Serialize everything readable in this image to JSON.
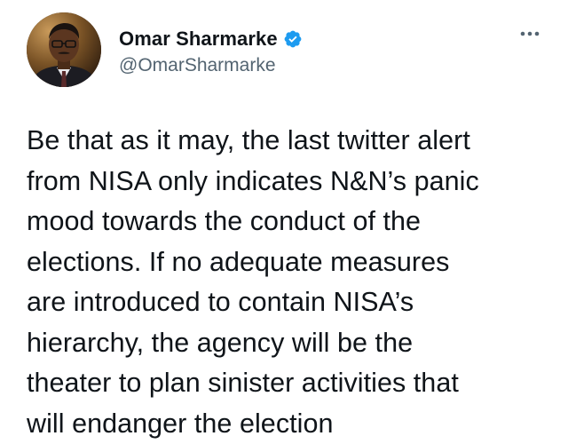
{
  "author": {
    "display_name": "Omar Sharmarke",
    "handle": "@OmarSharmarke",
    "verified": true,
    "verified_color": "#1d9bf0",
    "avatar_icon": "user-avatar-photo"
  },
  "menu": {
    "more_icon": "more-horizontal-icon"
  },
  "tweet": {
    "text": "Be that as it may, the last twitter alert\nfrom NISA only indicates N&N’s panic\nmood towards the conduct of the\nelections. If no adequate measures\nare introduced to contain NISA’s\nhierarchy, the agency will be the\ntheater to plan sinister activities that\nwill endanger the election"
  },
  "colors": {
    "text_primary": "#0f1419",
    "text_secondary": "#536471",
    "accent": "#1d9bf0",
    "background": "#ffffff"
  }
}
